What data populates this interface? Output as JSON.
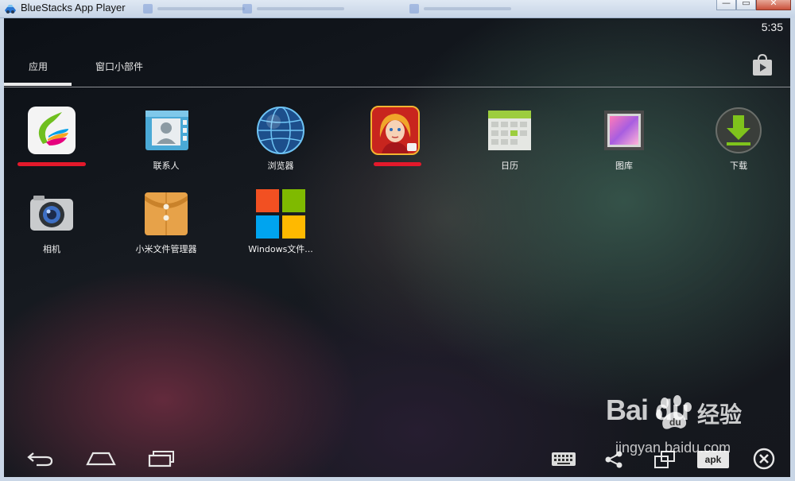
{
  "window": {
    "title": "BlueStacks App Player",
    "minimize_glyph": "—",
    "restore_glyph": "▭",
    "close_glyph": "✕"
  },
  "status": {
    "time": "5:35"
  },
  "tabs": [
    {
      "label": "应用",
      "active": true
    },
    {
      "label": "窗口小部件",
      "active": false
    }
  ],
  "apps": [
    {
      "label": "",
      "icon": "pea-pod-assistant-icon",
      "redacted": true
    },
    {
      "label": "联系人",
      "icon": "contacts-icon"
    },
    {
      "label": "浏览器",
      "icon": "browser-globe-icon"
    },
    {
      "label": "",
      "icon": "game-girl-icon",
      "redacted": true
    },
    {
      "label": "日历",
      "icon": "calendar-icon"
    },
    {
      "label": "图库",
      "icon": "gallery-icon"
    },
    {
      "label": "下载",
      "icon": "download-icon"
    },
    {
      "label": "相机",
      "icon": "camera-icon"
    },
    {
      "label": "小米文件管理器",
      "icon": "file-folder-icon"
    },
    {
      "label": "Windows文件...",
      "icon": "windows-logo-icon"
    }
  ],
  "navbar": {
    "icons": [
      "back-icon",
      "home-icon",
      "recent-apps-icon",
      "keyboard-icon",
      "share-icon",
      "multi-window-icon",
      "apk-icon",
      "close-circle-icon"
    ],
    "apk_label": "apk"
  },
  "watermark": {
    "brand": "Bai  du",
    "suffix": "经验",
    "url": "jingyan.baidu.com"
  },
  "colors": {
    "redaction": "#e3192b",
    "download_green": "#7fc31c",
    "ms_red": "#f25022",
    "ms_green": "#7fba00",
    "ms_blue": "#00a4ef",
    "ms_yellow": "#ffb900"
  }
}
